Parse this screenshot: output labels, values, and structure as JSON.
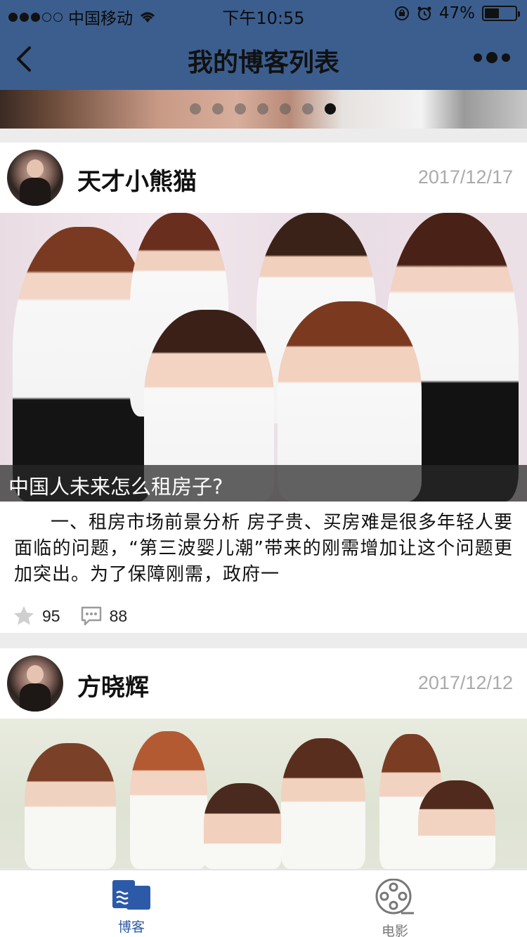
{
  "status_bar": {
    "carrier": "中国移动",
    "time": "下午10:55",
    "battery": "47%",
    "battery_level": 0.47
  },
  "nav": {
    "title": "我的博客列表"
  },
  "banner": {
    "dot_count": 7,
    "active_index": 6
  },
  "posts": [
    {
      "author": "天才小熊猫",
      "date": "2017/12/17",
      "caption": "中国人未来怎么租房子?",
      "excerpt": "一、租房市场前景分析 房子贵、买房难是很多年轻人要面临的问题，“第三波婴儿潮”带来的刚需增加让这个问题更加突出。为了保障刚需，政府一",
      "stars": "95",
      "comments": "88"
    },
    {
      "author": "方晓辉",
      "date": "2017/12/12"
    }
  ],
  "tabs": [
    {
      "label": "博客",
      "icon": "blog-icon",
      "active": true
    },
    {
      "label": "电影",
      "icon": "film-reel-icon",
      "active": false
    }
  ],
  "colors": {
    "nav_bg": "#3b5e8e",
    "tab_active": "#2c5aa8",
    "tab_inactive": "#777777"
  }
}
